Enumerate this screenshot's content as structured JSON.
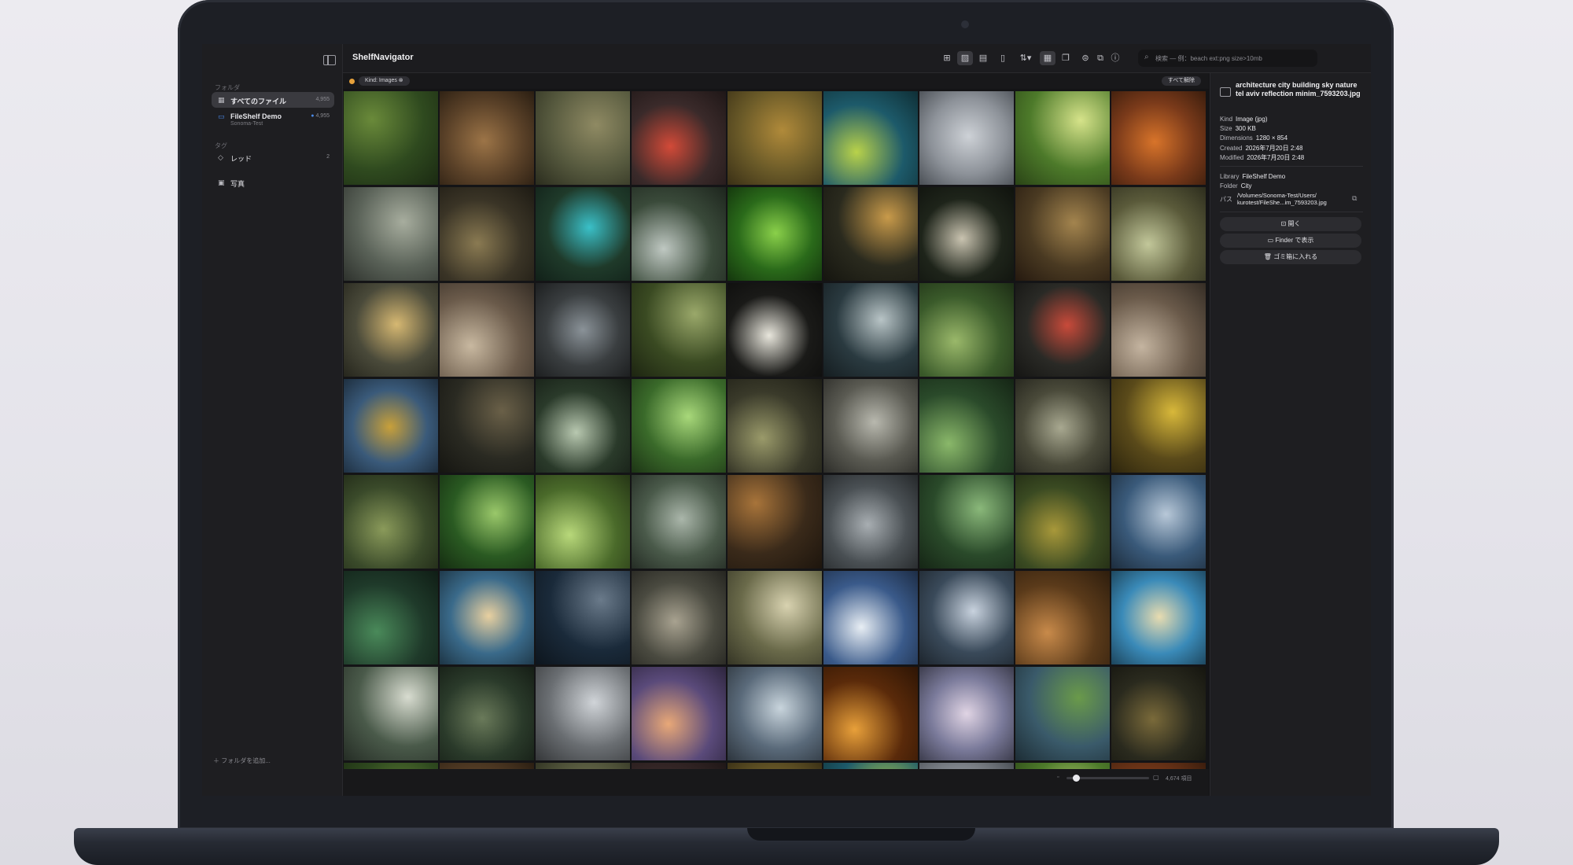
{
  "app": {
    "title": "ShelfNavigator"
  },
  "sidebar": {
    "folders_label": "フォルダ",
    "items": [
      {
        "label": "すべてのファイル",
        "count": "4,955",
        "icon": "grid-icon"
      },
      {
        "label": "FileShelf Demo",
        "sub": "Sonoma-Test",
        "count": "4,955",
        "icon": "library-icon"
      }
    ],
    "tags_label": "タグ",
    "tags": [
      {
        "label": "レッド",
        "count": "2",
        "icon": "tag-icon"
      },
      {
        "label": "写真",
        "icon": "photo-stack-icon"
      }
    ],
    "add_folder": "フォルダを追加..."
  },
  "toolbar": {
    "search_placeholder": "検索 — 例：beach ext:png size>10mb",
    "buttons": [
      "grid-view-icon",
      "image-view-icon",
      "film-icon",
      "document-icon",
      "sort-icon",
      "thumbnail-size-icon",
      "window-icon",
      "tag-filter-icon",
      "copy-icon",
      "info-icon"
    ]
  },
  "filter": {
    "chip": "Kind: Images",
    "clear_all": "すべて解除"
  },
  "status": {
    "item_count": "4,674 項目"
  },
  "inspector": {
    "filename": "architecture city building sky nature tel aviv reflection minim_7593203.jpg",
    "rows": [
      {
        "key": "Kind",
        "value": "Image (jpg)"
      },
      {
        "key": "Size",
        "value": "300 KB"
      },
      {
        "key": "Dimensions",
        "value": "1280 × 854"
      },
      {
        "key": "Created",
        "value": "2026年7月20日 2:48"
      },
      {
        "key": "Modified",
        "value": "2026年7月20日 2:48"
      }
    ],
    "rows2": [
      {
        "key": "Library",
        "value": "FileShelf Demo"
      },
      {
        "key": "Folder",
        "value": "City"
      }
    ],
    "path_label": "パス",
    "path_value": "/Volumes/Sonoma-Test/Users/ kurotest/FileShe...im_7593203.jpg",
    "actions": [
      {
        "label": "開く",
        "icon": "open-icon"
      },
      {
        "label": "Finder で表示",
        "icon": "folder-icon"
      },
      {
        "label": "ゴミ箱に入れる",
        "icon": "trash-icon"
      }
    ]
  },
  "thumbnails": {
    "palette": [
      [
        "#2f4a1f",
        "#6a8a3a",
        "#1b2a12"
      ],
      [
        "#5a4128",
        "#9c7447",
        "#2a1e12"
      ],
      [
        "#56593e",
        "#8f8a63",
        "#2b2d1e"
      ],
      [
        "#3a2a2a",
        "#d24a38",
        "#1f1717"
      ],
      [
        "#6a5a28",
        "#b08a3a",
        "#3a3016"
      ],
      [
        "#1d5a6a",
        "#b9d24a",
        "#0f2f36"
      ],
      [
        "#8d9299",
        "#cdd1d6",
        "#4a4f55"
      ],
      [
        "#4d7a2a",
        "#d6e38a",
        "#2a4416"
      ],
      [
        "#7a3a1a",
        "#d8742a",
        "#3a1d0d"
      ],
      [
        "#5a6258",
        "#a7ad9e",
        "#2e322d"
      ],
      [
        "#3a3426",
        "#8a7a52",
        "#1d1a13"
      ],
      [
        "#1f3a2a",
        "#3ac0c8",
        "#112018"
      ],
      [
        "#3a4a3a",
        "#bfc8c2",
        "#1d251d"
      ],
      [
        "#2a6a1a",
        "#8ad04a",
        "#14360d"
      ],
      [
        "#2a2a1e",
        "#c89a4a",
        "#15150f"
      ],
      [
        "#1e241a",
        "#c9c3b0",
        "#0f120d"
      ],
      [
        "#4a3a22",
        "#a3844e",
        "#25190f"
      ],
      [
        "#5a5a3a",
        "#c2c79a",
        "#2d2d1d"
      ],
      [
        "#4a4a3a",
        "#d6b872",
        "#26261d"
      ],
      [
        "#6a5a4a",
        "#c8b8a0",
        "#352d25"
      ],
      [
        "#3a3e40",
        "#8a9298",
        "#1d1f20"
      ],
      [
        "#3a4a22",
        "#9aa86a",
        "#1d2511"
      ],
      [
        "#1a1a18",
        "#e8e6dc",
        "#0d0d0c"
      ],
      [
        "#2a3a40",
        "#b8c4c6",
        "#151d20"
      ],
      [
        "#3a5a2a",
        "#9ab86a",
        "#1d2d15"
      ],
      [
        "#2a2a26",
        "#c84a3a",
        "#151513"
      ],
      [
        "#6a5a4a",
        "#c4b4a0",
        "#352d25"
      ],
      [
        "#3a5a7a",
        "#c8a03a",
        "#1d2d3d"
      ],
      [
        "#2a2a22",
        "#6a6048",
        "#151511"
      ],
      [
        "#2a3a2a",
        "#b8c8b0",
        "#151d15"
      ],
      [
        "#3a6a2a",
        "#a8d87a",
        "#1d3515"
      ],
      [
        "#3a3a2a",
        "#9a9a6a",
        "#1d1d15"
      ],
      [
        "#5a5a52",
        "#b8b8ae",
        "#2d2d29"
      ],
      [
        "#2a4a2a",
        "#8ab86a",
        "#152515"
      ],
      [
        "#4a4a3a",
        "#a8a890",
        "#25251d"
      ],
      [
        "#5a4a1a",
        "#d8b83a",
        "#2d250d"
      ],
      [
        "#3a4a2a",
        "#8a9a5a",
        "#1d2515"
      ],
      [
        "#2a5a22",
        "#9ac86a",
        "#152d11"
      ],
      [
        "#4a6a2a",
        "#b8d87a",
        "#253515"
      ],
      [
        "#4a5a4a",
        "#aab6aa",
        "#252d25"
      ],
      [
        "#3a2a1a",
        "#a8743a",
        "#1d150d"
      ],
      [
        "#4a5054",
        "#a8aeb2",
        "#25282a"
      ],
      [
        "#2a4a2a",
        "#8ab87a",
        "#152515"
      ],
      [
        "#3a4a22",
        "#a8983a",
        "#1d2511"
      ],
      [
        "#3a5a7a",
        "#b8c8d8",
        "#1d2d3d"
      ],
      [
        "#1f3a2a",
        "#4a8a5a",
        "#0f1d15"
      ],
      [
        "#3a6a8a",
        "#e8d0a0",
        "#1d3545"
      ],
      [
        "#1a2a3a",
        "#6a7a8a",
        "#0d151d"
      ],
      [
        "#4a4a40",
        "#a8a290",
        "#252520"
      ],
      [
        "#6a6a4a",
        "#d8d2b0",
        "#353525"
      ],
      [
        "#3a5a8a",
        "#e8eef4",
        "#1d2d45"
      ],
      [
        "#3a4a5a",
        "#c8d2de",
        "#1d252d"
      ],
      [
        "#5a3a1a",
        "#c88a4a",
        "#2d1d0d"
      ],
      [
        "#3a8ab8",
        "#e8dcb0",
        "#1d455c"
      ],
      [
        "#4a5a4a",
        "#d8dcd0",
        "#252d25"
      ],
      [
        "#2a3a2a",
        "#6a7a5a",
        "#151d15"
      ],
      [
        "#6a6e72",
        "#d0d4d8",
        "#353739"
      ],
      [
        "#5a4a7a",
        "#e8a878",
        "#2d253d"
      ],
      [
        "#5a6a7a",
        "#c8d4dc",
        "#2d353d"
      ],
      [
        "#5a2a0a",
        "#e8a03a",
        "#2d1505"
      ],
      [
        "#7a7a9a",
        "#e0d4e4",
        "#3d3d4d"
      ],
      [
        "#3a5a6a",
        "#6a9a4a",
        "#1d2d35"
      ],
      [
        "#2a2a1e",
        "#7a6a3a",
        "#15150f"
      ]
    ]
  }
}
